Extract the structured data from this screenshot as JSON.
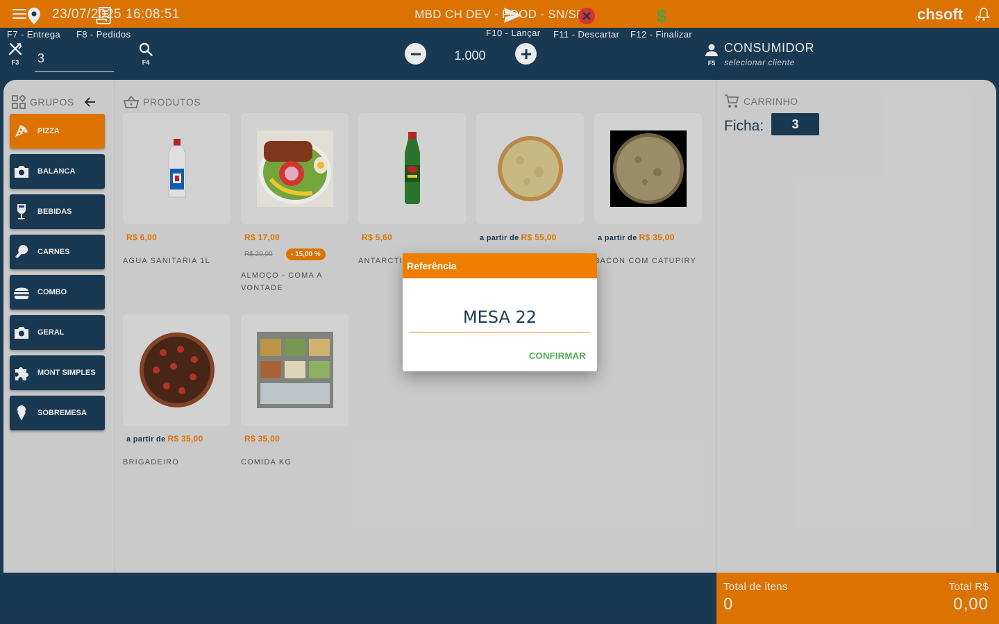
{
  "topbar": {
    "datetime": "23/07/2025 16:08:51",
    "store": "MBD CH DEV - FOOD - SN/SP",
    "brand": "chsoft",
    "bell_count": "0"
  },
  "toolbar": {
    "table_key": "F3",
    "table_value": "3",
    "search_key": "F4",
    "quantity": "1.000",
    "customer_key": "F5",
    "customer_name": "CONSUMIDOR",
    "customer_select": "selecionar cliente"
  },
  "groups": {
    "title": "GRUPOS",
    "items": [
      {
        "label": "PIZZA",
        "icon": "pizza-icon",
        "active": true
      },
      {
        "label": "BALANCA",
        "icon": "camera-icon",
        "active": false
      },
      {
        "label": "BEBIDAS",
        "icon": "wine-glass-icon",
        "active": false
      },
      {
        "label": "CARNES",
        "icon": "meat-icon",
        "active": false
      },
      {
        "label": "COMBO",
        "icon": "burger-icon",
        "active": false
      },
      {
        "label": "GERAL",
        "icon": "camera-icon",
        "active": false
      },
      {
        "label": "MONT SIMPLES",
        "icon": "puzzle-icon",
        "active": false
      },
      {
        "label": "SOBREMESA",
        "icon": "ice-cream-icon",
        "active": false
      }
    ]
  },
  "products": {
    "title": "PRODUTOS",
    "items": [
      {
        "name": "AGUA SANITARIA 1L",
        "price": "R$ 6,00",
        "prefix": "",
        "img": "bleach-bottle"
      },
      {
        "name": "ALMOÇO - COMA A VONTADE",
        "price": "R$ 17,00",
        "prefix": "",
        "old_price": "R$ 20,00",
        "discount": "- 15,00 %",
        "img": "lunch-plate"
      },
      {
        "name": "ANTARCTI",
        "price": "R$ 5,60",
        "prefix": "",
        "img": "soda-bottle"
      },
      {
        "name": "",
        "price": "R$ 55,00",
        "prefix": "a partir de",
        "img": "pizza-cheese"
      },
      {
        "name": "BACON COM CATUPIRY",
        "price": "R$ 35,00",
        "prefix": "a partir de",
        "img": "pizza-dark"
      },
      {
        "name": "BRIGADEIRO",
        "price": "R$ 35,00",
        "prefix": "a partir de",
        "img": "pizza-brigadeiro"
      },
      {
        "name": "COMIDA KG",
        "price": "R$ 35,00",
        "prefix": "",
        "img": "buffet-kg"
      }
    ]
  },
  "cart": {
    "title": "CARRINHO",
    "ficha_label": "Ficha:",
    "ficha_value": "3"
  },
  "dialog": {
    "title": "Referência",
    "value": "MESA 22",
    "confirm": "CONFIRMAR"
  },
  "footer": {
    "entrega": "F7 - Entrega",
    "pedidos": "F8 - Pedidos",
    "lancar": "F10 - Lançar",
    "descartar": "F11 - Descartar",
    "finalizar": "F12 - Finalizar"
  },
  "totals": {
    "items_label": "Total de itens",
    "items_value": "0",
    "total_label": "Total R$",
    "total_value": "0,00"
  },
  "colors": {
    "accent": "#ef7d00",
    "navy": "#1c3d58",
    "confirm": "#4caf50",
    "discard": "#e53935"
  }
}
